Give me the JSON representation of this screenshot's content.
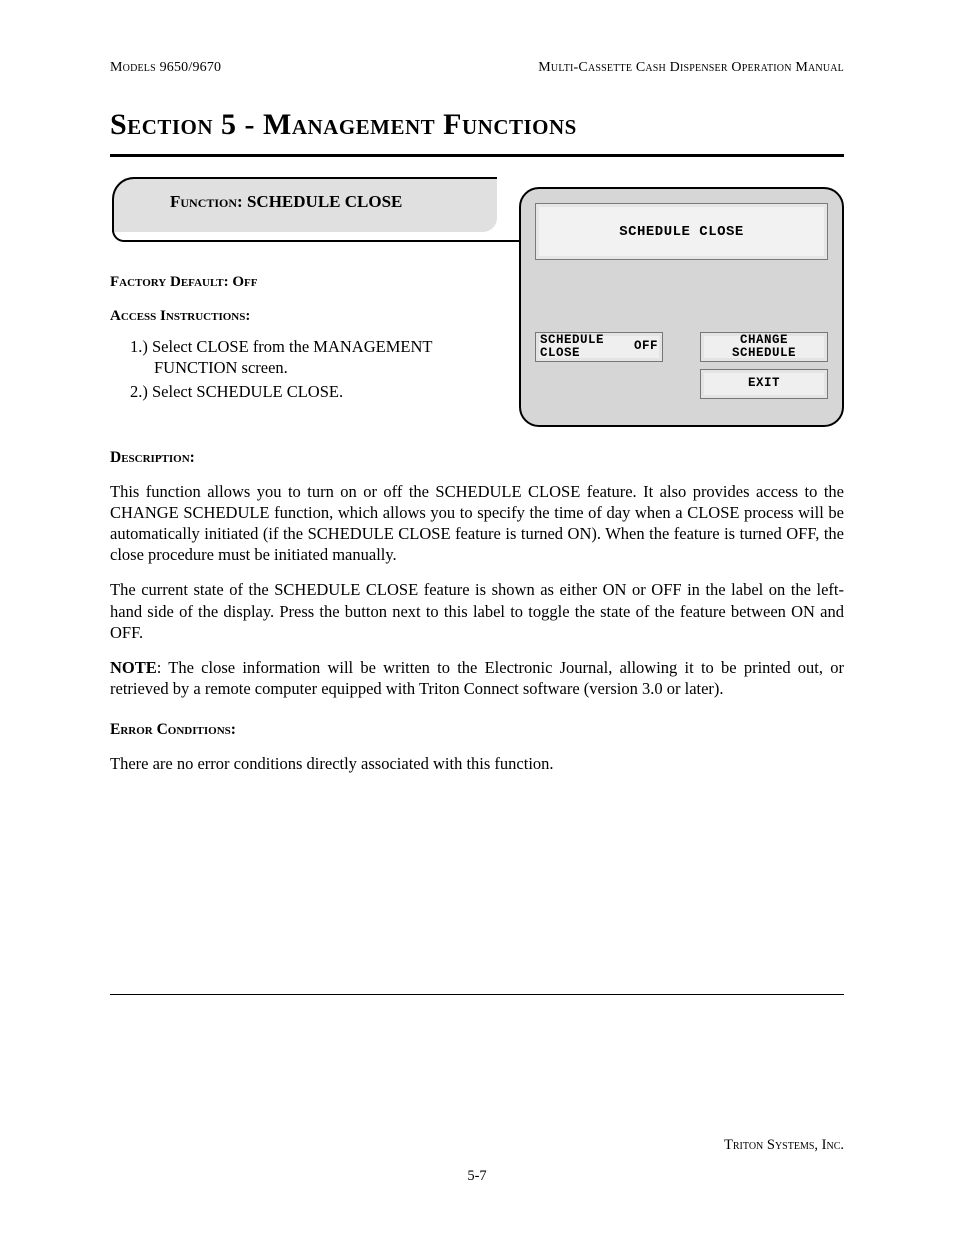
{
  "header": {
    "left": "Models 9650/9670",
    "right": "Multi-Cassette Cash Dispenser Operation Manual"
  },
  "section_title": "Section 5 - Management Functions",
  "function_box": {
    "label": "Function: ",
    "name": "SCHEDULE CLOSE"
  },
  "factory_default": {
    "label": "Factory Default: ",
    "value": "Off"
  },
  "access": {
    "label": "Access Instructions:",
    "steps": [
      "1.)  Select CLOSE from the MANAGEMENT FUNCTION screen.",
      "2.)  Select SCHEDULE CLOSE."
    ]
  },
  "atm": {
    "title": "SCHEDULE CLOSE",
    "left_label": "SCHEDULE\nCLOSE",
    "state": "OFF",
    "btn_change": "CHANGE\nSCHEDULE",
    "btn_exit": "EXIT"
  },
  "description": {
    "label": "Description:",
    "p1": "This function allows you to turn on or off the SCHEDULE CLOSE feature. It also provides access to the CHANGE SCHEDULE function, which allows you to specify the time of day when a CLOSE process will be automatically initiated (if the SCHEDULE CLOSE feature is turned ON). When the feature is turned OFF, the close procedure must be initiated manually.",
    "p2": "The current state of the SCHEDULE CLOSE feature is shown as either ON or OFF in the label on the left-hand side of the display. Press the button next to this label to toggle the state of the feature between ON and OFF.",
    "note_label": "NOTE",
    "note_body": ": The close information will be written to the Electronic Journal, allowing it to be printed out, or retrieved by a remote computer equipped with Triton Connect software (version 3.0 or later)."
  },
  "errors": {
    "label": "Error Conditions:",
    "body": "There are no error conditions directly associated with this function."
  },
  "footer": {
    "company": "Triton Systems, Inc.",
    "page": "5-7"
  }
}
